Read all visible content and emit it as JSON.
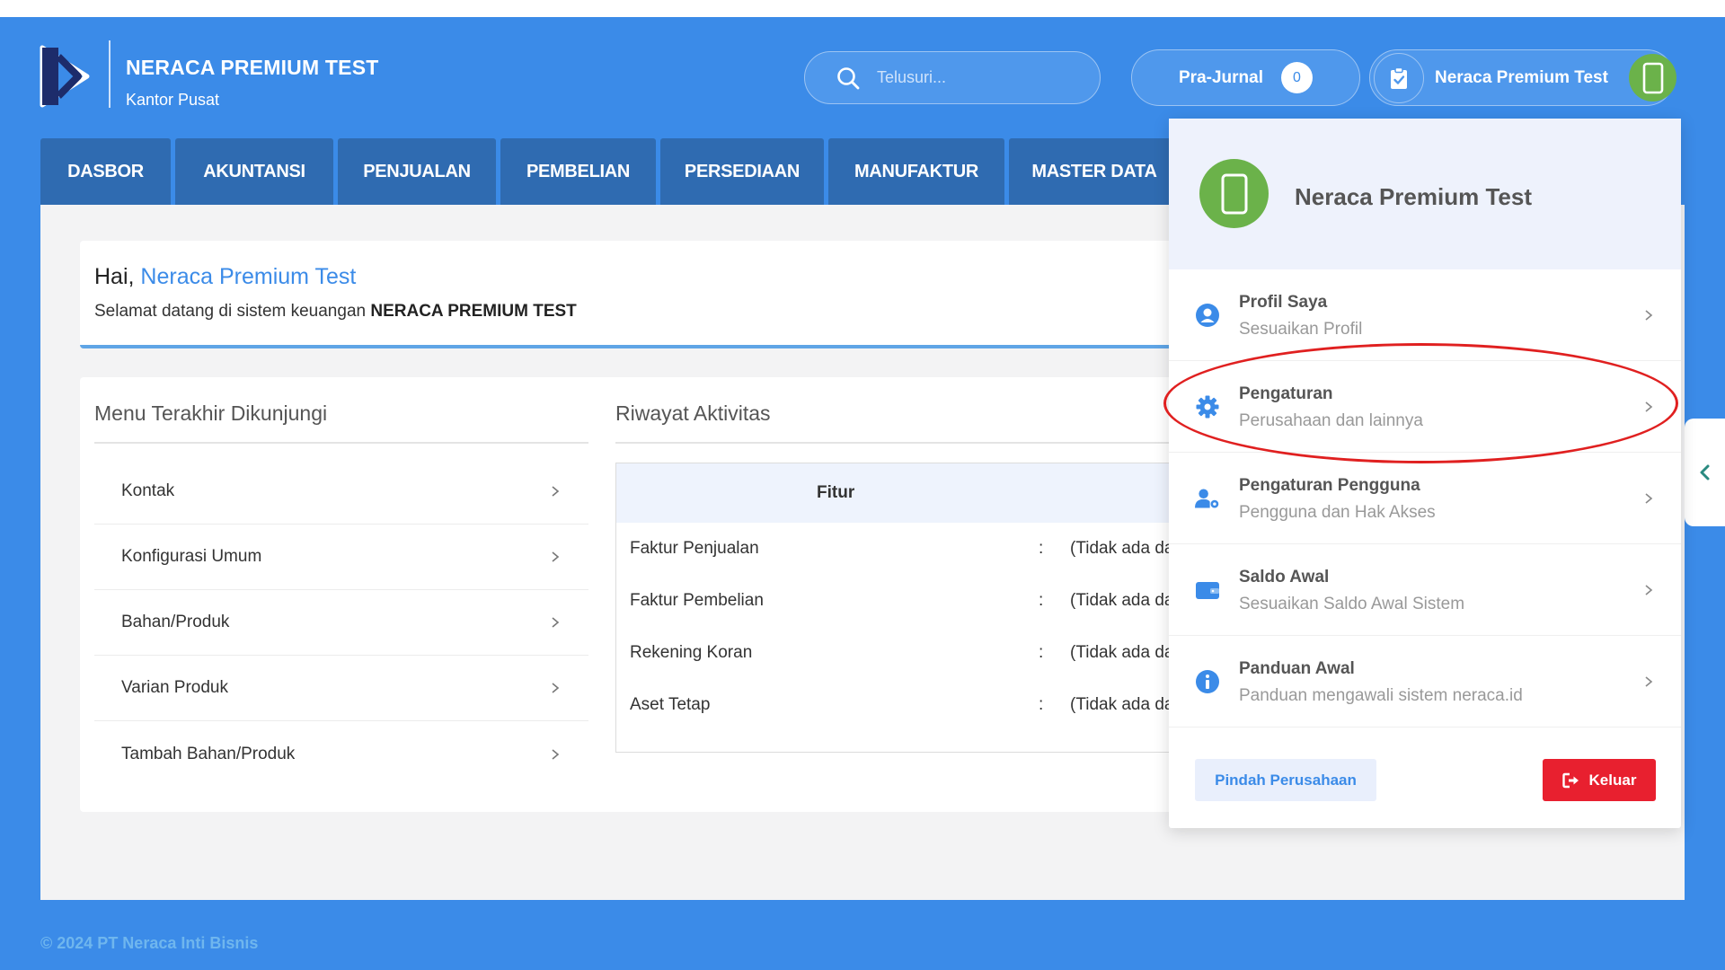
{
  "brand": {
    "title": "NERACA PREMIUM TEST",
    "subtitle": "Kantor Pusat"
  },
  "search": {
    "placeholder": "Telusuri..."
  },
  "prajurnal": {
    "label": "Pra-Jurnal",
    "count": "0"
  },
  "user": {
    "name": "Neraca Premium Test"
  },
  "nav": [
    {
      "label": "DASBOR"
    },
    {
      "label": "AKUNTANSI"
    },
    {
      "label": "PENJUALAN"
    },
    {
      "label": "PEMBELIAN"
    },
    {
      "label": "PERSEDIAAN"
    },
    {
      "label": "MANUFAKTUR"
    },
    {
      "label": "MASTER DATA"
    }
  ],
  "welcome": {
    "greeting": "Hai,",
    "name": "Neraca Premium Test",
    "text": "Selamat datang di sistem keuangan ",
    "company": "NERACA PREMIUM TEST"
  },
  "recent": {
    "title": "Menu Terakhir Dikunjungi",
    "items": [
      {
        "label": "Kontak"
      },
      {
        "label": "Konfigurasi Umum"
      },
      {
        "label": "Bahan/Produk"
      },
      {
        "label": "Varian Produk"
      },
      {
        "label": "Tambah Bahan/Produk"
      }
    ]
  },
  "activity": {
    "title": "Riwayat Aktivitas",
    "column": "Fitur",
    "rows": [
      {
        "name": "Faktur Penjualan",
        "sep": ":",
        "value": "(Tidak ada da"
      },
      {
        "name": "Faktur Pembelian",
        "sep": ":",
        "value": "(Tidak ada da"
      },
      {
        "name": "Rekening Koran",
        "sep": ":",
        "value": "(Tidak ada da"
      },
      {
        "name": "Aset Tetap",
        "sep": ":",
        "value": "(Tidak ada da"
      }
    ]
  },
  "dropdown": {
    "name": "Neraca Premium Test",
    "items": [
      {
        "title": "Profil Saya",
        "subtitle": "Sesuaikan Profil",
        "icon": "user-circle-icon"
      },
      {
        "title": "Pengaturan",
        "subtitle": "Perusahaan dan lainnya",
        "icon": "gear-icon"
      },
      {
        "title": "Pengaturan Pengguna",
        "subtitle": "Pengguna dan Hak Akses",
        "icon": "user-settings-icon"
      },
      {
        "title": "Saldo Awal",
        "subtitle": "Sesuaikan Saldo Awal Sistem",
        "icon": "wallet-icon"
      },
      {
        "title": "Panduan Awal",
        "subtitle": "Panduan mengawali sistem neraca.id",
        "icon": "info-icon"
      }
    ],
    "switch_label": "Pindah Perusahaan",
    "logout_label": "Keluar"
  },
  "footer": {
    "text": "© 2024 PT Neraca Inti Bisnis"
  },
  "colors": {
    "primary": "#3b8be8",
    "nav": "#2f6bb1",
    "avatar": "#6bb24a",
    "danger": "#e8202f",
    "highlight": "#e02020"
  }
}
